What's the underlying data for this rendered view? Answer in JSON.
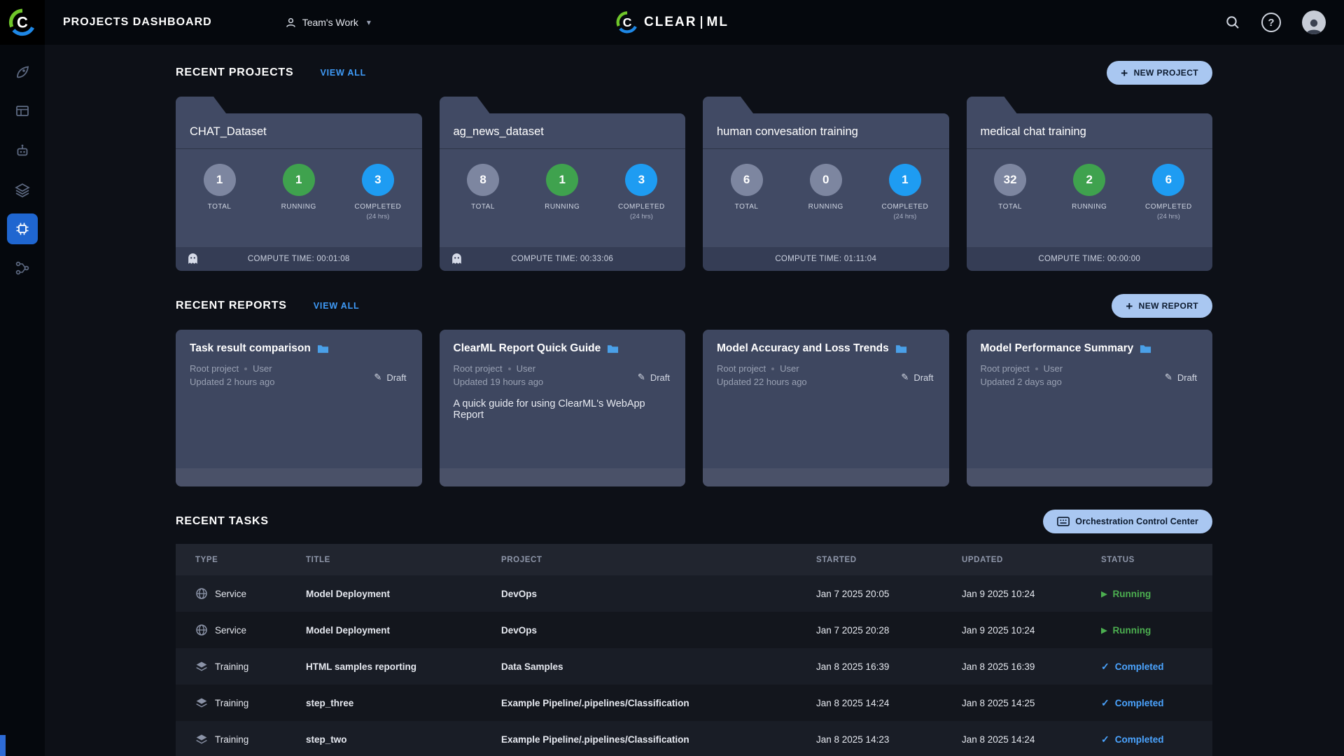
{
  "header": {
    "title": "PROJECTS DASHBOARD",
    "workspace": "Team's Work",
    "brand_clear": "CLEAR",
    "brand_ml": "ML"
  },
  "icons": {
    "plus": "+",
    "caret_down": "▾",
    "help": "?",
    "running_play": "▶",
    "completed_check": "✓",
    "draft_pencil": "✎"
  },
  "sidebar": {
    "items": [
      {
        "icon": "dashboard-rocket-icon",
        "active": false
      },
      {
        "icon": "projects-board-icon",
        "active": false
      },
      {
        "icon": "workers-robot-icon",
        "active": false
      },
      {
        "icon": "datasets-layers-icon",
        "active": false
      },
      {
        "icon": "orchestration-chip-icon",
        "active": true
      },
      {
        "icon": "pipelines-flow-icon",
        "active": false
      }
    ]
  },
  "projects": {
    "section_title": "RECENT PROJECTS",
    "view_all": "VIEW ALL",
    "new_button": "NEW PROJECT",
    "labels": {
      "total": "TOTAL",
      "running": "RUNNING",
      "completed": "COMPLETED",
      "completed_sub": "(24 hrs)"
    },
    "cards": [
      {
        "name": "CHAT_Dataset",
        "total": "1",
        "running": "1",
        "completed": "3",
        "compute_time": "COMPUTE TIME: 00:01:08"
      },
      {
        "name": "ag_news_dataset",
        "total": "8",
        "running": "1",
        "completed": "3",
        "compute_time": "COMPUTE TIME: 00:33:06"
      },
      {
        "name": "human convesation training",
        "total": "6",
        "running": "0",
        "completed": "1",
        "compute_time": "COMPUTE TIME: 01:11:04"
      },
      {
        "name": "medical chat training",
        "total": "32",
        "running": "2",
        "completed": "6",
        "compute_time": "COMPUTE TIME: 00:00:00"
      }
    ]
  },
  "reports": {
    "section_title": "RECENT REPORTS",
    "view_all": "VIEW ALL",
    "new_button": "NEW REPORT",
    "cards": [
      {
        "title": "Task result comparison",
        "project": "Root project",
        "author": "User",
        "updated": "Updated 2 hours ago",
        "badge": "Draft",
        "description": ""
      },
      {
        "title": "ClearML Report Quick Guide",
        "project": "Root project",
        "author": "User",
        "updated": "Updated 19 hours ago",
        "badge": "Draft",
        "description": "A quick guide for using ClearML's WebApp Report"
      },
      {
        "title": "Model Accuracy and Loss Trends",
        "project": "Root project",
        "author": "User",
        "updated": "Updated 22 hours ago",
        "badge": "Draft",
        "description": ""
      },
      {
        "title": "Model Performance Summary",
        "project": "Root project",
        "author": "User",
        "updated": "Updated 2 days ago",
        "badge": "Draft",
        "description": ""
      }
    ]
  },
  "tasks": {
    "section_title": "RECENT TASKS",
    "orchestration_button": "Orchestration Control Center",
    "columns": {
      "type": "TYPE",
      "title": "TITLE",
      "project": "PROJECT",
      "started": "STARTED",
      "updated": "UPDATED",
      "status": "STATUS"
    },
    "rows": [
      {
        "type": "Service",
        "title": "Model Deployment",
        "project": "DevOps",
        "started": "Jan 7 2025 20:05",
        "updated": "Jan 9 2025 10:24",
        "status": "Running"
      },
      {
        "type": "Service",
        "title": "Model Deployment",
        "project": "DevOps",
        "started": "Jan 7 2025 20:28",
        "updated": "Jan 9 2025 10:24",
        "status": "Running"
      },
      {
        "type": "Training",
        "title": "HTML samples reporting",
        "project": "Data Samples",
        "started": "Jan 8 2025 16:39",
        "updated": "Jan 8 2025 16:39",
        "status": "Completed"
      },
      {
        "type": "Training",
        "title": "step_three",
        "project": "Example Pipeline/.pipelines/Classification",
        "started": "Jan 8 2025 14:24",
        "updated": "Jan 8 2025 14:25",
        "status": "Completed"
      },
      {
        "type": "Training",
        "title": "step_two",
        "project": "Example Pipeline/.pipelines/Classification",
        "started": "Jan 8 2025 14:23",
        "updated": "Jan 8 2025 14:24",
        "status": "Completed"
      }
    ]
  },
  "colors": {
    "running_green": "#4caf50",
    "completed_blue": "#4ba4ff",
    "link_blue": "#3f9bf8",
    "button_bg": "#a9c7f1",
    "active_nav": "#1f66d0",
    "card_bg": "#414a64"
  }
}
